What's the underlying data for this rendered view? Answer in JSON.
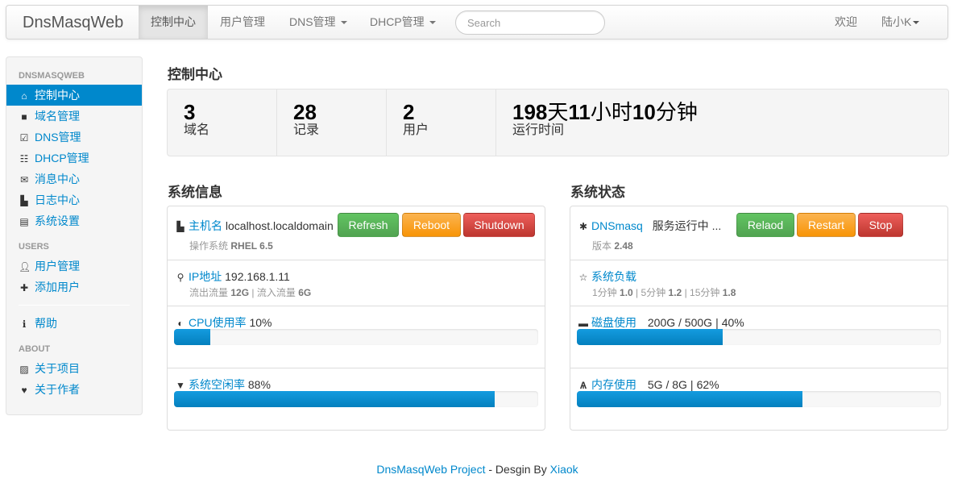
{
  "navbar": {
    "brand": "DnsMasqWeb",
    "items": [
      "控制中心",
      "用户管理",
      "DNS管理",
      "DHCP管理"
    ],
    "search_placeholder": "Search",
    "welcome": "欢迎",
    "user": "陆小K"
  },
  "sidebar": {
    "header1": "DNSMASQWEB",
    "items1": [
      "控制中心",
      "域名管理",
      "DNS管理",
      "DHCP管理",
      "消息中心",
      "日志中心",
      "系统设置"
    ],
    "header2": "USERS",
    "items2": [
      "用户管理",
      "添加用户"
    ],
    "help": "帮助",
    "header3": "ABOUT",
    "items3": [
      "关于项目",
      "关于作者"
    ]
  },
  "main": {
    "title": "控制中心",
    "stats": [
      {
        "num": "3",
        "label": "域名"
      },
      {
        "num": "28",
        "label": "记录"
      },
      {
        "num": "2",
        "label": "用户"
      },
      {
        "num_a": "198",
        "unit_a": "天",
        "num_b": "11",
        "unit_b": "小时",
        "num_c": "10",
        "unit_c": "分钟",
        "label": "运行时间"
      }
    ]
  },
  "sysinfo": {
    "title": "系统信息",
    "host_label": "主机名",
    "host_value": "localhost.localdomain",
    "os_label": "操作系统",
    "os_value": "RHEL 6.5",
    "btn_refresh": "Refresh",
    "btn_reboot": "Reboot",
    "btn_shutdown": "Shutdown",
    "ip_label": "IP地址",
    "ip_value": "192.168.1.11",
    "out_label": "流出流量",
    "out_value": "12G",
    "in_label": "流入流量",
    "in_value": "6G",
    "cpu_label": "CPU使用率",
    "cpu_value": "10%",
    "cpu_fraction": 0.1,
    "idle_label": "系统空闲率",
    "idle_value": "88%",
    "idle_fraction": 0.88
  },
  "sysstatus": {
    "title": "系统状态",
    "svc_label": "DNSmasq",
    "svc_state": "服务运行中 ...",
    "ver_label": "版本",
    "ver_value": "2.48",
    "btn_reload": "Relaod",
    "btn_restart": "Restart",
    "btn_stop": "Stop",
    "load_label": "系统负载",
    "load1_label": "1分钟",
    "load1_value": "1.0",
    "load5_label": "5分钟",
    "load5_value": "1.2",
    "load15_label": "15分钟",
    "load15_value": "1.8",
    "disk_label": "磁盘使用",
    "disk_value": "200G / 500G",
    "disk_pct": "40%",
    "disk_fraction": 0.4,
    "mem_label": "内存使用",
    "mem_value": "5G / 8G",
    "mem_pct": "62%",
    "mem_fraction": 0.62
  },
  "footer": {
    "project": "DnsMasqWeb Project",
    "middle": " - Desgin By ",
    "author": "Xiaok"
  }
}
